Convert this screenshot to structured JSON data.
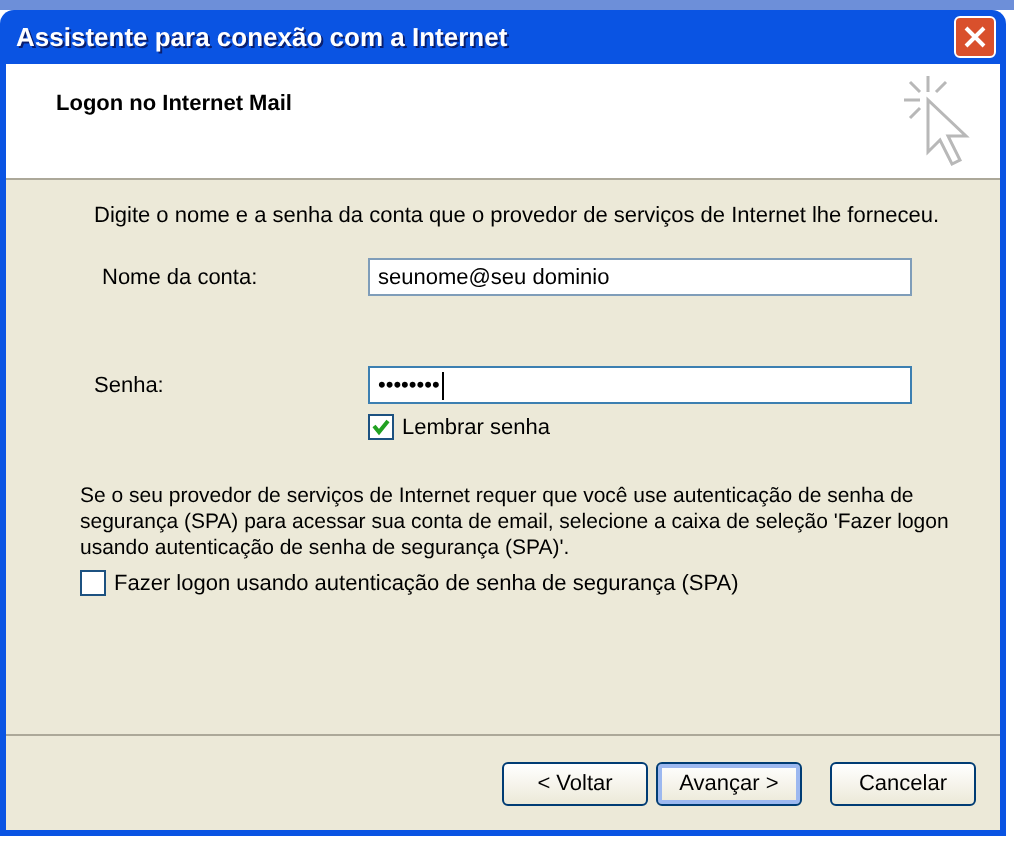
{
  "window": {
    "title": "Assistente para conexão com a Internet"
  },
  "header": {
    "title": "Logon no Internet Mail"
  },
  "intro": "Digite o nome e a senha da conta que o provedor de serviços de Internet lhe forneceu.",
  "fields": [
    {
      "label": "Nome da conta:",
      "value": "seunome@seu dominio",
      "focused": false
    },
    {
      "label": "Senha:",
      "value": "••••••••",
      "focused": true
    }
  ],
  "remember": {
    "label": "Lembrar senha",
    "checked": true
  },
  "spa_note": "Se o seu provedor de serviços de Internet requer que você use autenticação de senha de segurança (SPA) para acessar sua conta de email, selecione a caixa de seleção 'Fazer logon usando autenticação de senha de segurança (SPA)'.",
  "spa": {
    "label": "Fazer logon usando autenticação de senha de segurança (SPA)",
    "checked": false
  },
  "buttons": [
    {
      "label": "< Voltar",
      "default": false
    },
    {
      "label": "Avançar >",
      "default": true
    },
    {
      "label": "Cancelar",
      "default": false
    }
  ]
}
